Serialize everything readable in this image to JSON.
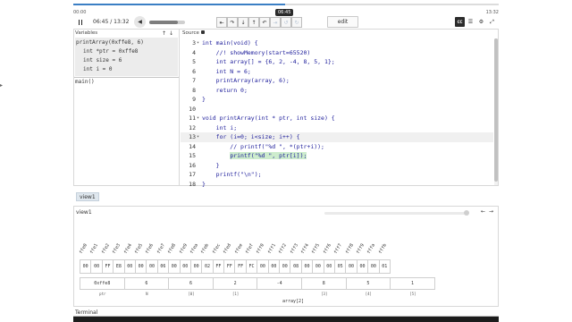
{
  "playback": {
    "time_start": "00:00",
    "time_end": "13:32",
    "current_bubble": "06:45",
    "time_readout": "06:45 / 13:32",
    "progress_fraction": 0.4987,
    "volume_fraction": 0.8
  },
  "controls": {
    "step_icons": [
      "step-start-icon",
      "step-over-icon",
      "step-into-icon",
      "step-out-icon",
      "step-back-icon",
      "run-icon",
      "undo-icon",
      "redo-icon"
    ],
    "step_glyphs": [
      "⇤",
      "↷",
      "↓",
      "↑",
      "↶",
      "⇥",
      "↺",
      "↻"
    ],
    "edit_label": "edit",
    "right_icons": [
      "cc-icon",
      "menu-icon",
      "settings-icon",
      "expand-icon"
    ],
    "right_glyphs": [
      "CC",
      "☰",
      "⚙",
      "⤢"
    ]
  },
  "variables": {
    "header": "Variables",
    "arrows": "↑↓",
    "frame_title": "printArray(0xffe8, 6)",
    "rows": [
      {
        "name": "int *ptr",
        "value": "0xffe8"
      },
      {
        "name": "int size",
        "value": "6"
      },
      {
        "name": "int i",
        "value": "0"
      }
    ],
    "main_frame": "main()"
  },
  "source": {
    "header": "Source",
    "lines": [
      {
        "num": "3",
        "fold": "▾",
        "text": "int main(void) {"
      },
      {
        "num": "4",
        "fold": "",
        "text": "    //! showMemory(start=65520)"
      },
      {
        "num": "5",
        "fold": "",
        "text": "    int array[] = {6, 2, -4, 8, 5, 1};"
      },
      {
        "num": "6",
        "fold": "",
        "text": "    int N = 6;"
      },
      {
        "num": "7",
        "fold": "",
        "text": "    printArray(array, 6);"
      },
      {
        "num": "8",
        "fold": "",
        "text": "    return 0;"
      },
      {
        "num": "9",
        "fold": "",
        "text": "}"
      },
      {
        "num": "10",
        "fold": "",
        "text": ""
      },
      {
        "num": "11",
        "fold": "▾",
        "text": "void printArray(int * ptr, int size) {"
      },
      {
        "num": "12",
        "fold": "",
        "text": "    int i;"
      },
      {
        "num": "13",
        "fold": "▾",
        "text": "    for (i=0; i<size; i++) {"
      },
      {
        "num": "14",
        "fold": "",
        "text": "        // printf(\"%d \", *(ptr+i));"
      },
      {
        "num": "15",
        "fold": "",
        "text": "        printf(\"%d \", ptr[i]);"
      },
      {
        "num": "16",
        "fold": "",
        "text": "    }"
      },
      {
        "num": "17",
        "fold": "",
        "text": "    printf(\"\\n\");"
      },
      {
        "num": "18",
        "fold": "",
        "text": "}"
      }
    ],
    "current_line": "13",
    "highlight_line": "15",
    "highlight_text": "printf(\"%d \", ptr[i]);"
  },
  "view_tab": "view1",
  "memory": {
    "title": "view1",
    "nav_glyphs": [
      "←",
      "→"
    ],
    "addresses": [
      "ffe0",
      "ffe1",
      "ffe2",
      "ffe3",
      "ffe4",
      "ffe5",
      "ffe6",
      "ffe7",
      "ffe8",
      "ffe9",
      "ffea",
      "ffeb",
      "ffec",
      "ffed",
      "ffee",
      "ffef",
      "fff0",
      "fff1",
      "fff2",
      "fff3",
      "fff4",
      "fff5",
      "fff6",
      "fff7",
      "fff8",
      "fff9",
      "fffa",
      "fffb",
      "fffc",
      "fffd",
      "fffe",
      "ffff"
    ],
    "bytes": [
      "00",
      "00",
      "FF",
      "E8",
      "00",
      "00",
      "00",
      "06",
      "00",
      "00",
      "00",
      "02",
      "FF",
      "FF",
      "FF",
      "FC",
      "00",
      "00",
      "00",
      "08",
      "00",
      "00",
      "00",
      "05",
      "00",
      "00",
      "00",
      "01"
    ],
    "values": [
      {
        "value": "0xffe8",
        "label": "ptr",
        "span": 4
      },
      {
        "value": "6",
        "label": "N",
        "span": 4
      },
      {
        "value": "6",
        "label": "[0]",
        "span": 4
      },
      {
        "value": "2",
        "label": "[1]",
        "span": 4
      },
      {
        "value": "-4",
        "label": "",
        "span": 4
      },
      {
        "value": "8",
        "label": "[3]",
        "span": 4
      },
      {
        "value": "5",
        "label": "[4]",
        "span": 4
      },
      {
        "value": "1",
        "label": "[5]",
        "span": 4
      }
    ],
    "array_caption": "array[2]"
  },
  "terminal": {
    "label": "Terminal"
  }
}
